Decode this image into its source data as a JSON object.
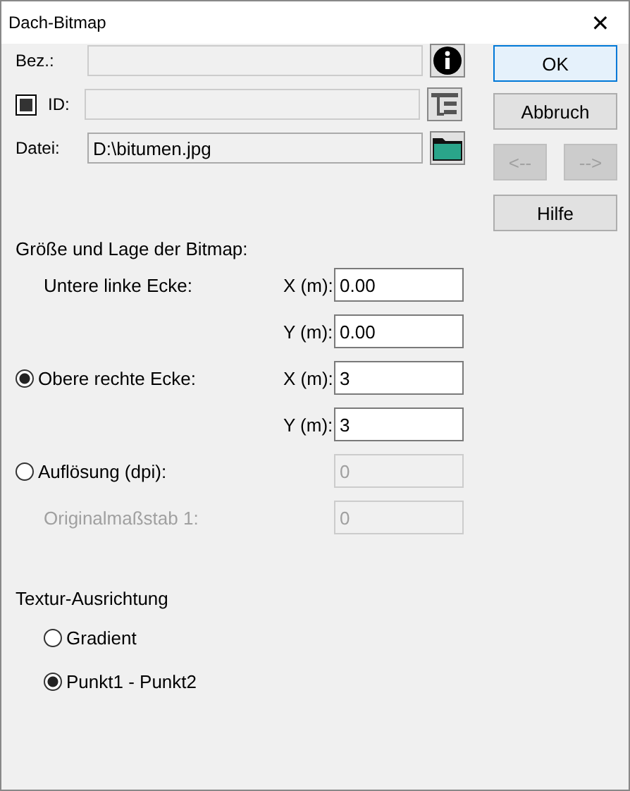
{
  "window": {
    "title": "Dach-Bitmap",
    "close": "✕"
  },
  "fields": [
    {
      "kind": "info",
      "label": "Bez.:"
    },
    {
      "kind": "id",
      "label": "ID:",
      "checked": true
    },
    {
      "kind": "file",
      "label": "Datei:",
      "value": "D:\\bitumen.jpg"
    }
  ],
  "buttons": [
    {
      "label": "OK",
      "default": true,
      "disabled": false,
      "wide": true
    },
    {
      "label": "Abbruch",
      "default": false,
      "disabled": false,
      "wide": true
    },
    {
      "label": "<--",
      "default": false,
      "disabled": true,
      "wide": false
    },
    {
      "label": "-->",
      "default": false,
      "disabled": true,
      "wide": false
    },
    {
      "label": "Hilfe",
      "default": false,
      "disabled": false,
      "wide": true
    }
  ],
  "size": {
    "title": "Größe und Lage der Bitmap:",
    "rows": [
      {
        "kind": "label",
        "label": "Untere linke Ecke:",
        "disabled": false,
        "field_label": "X (m):",
        "value": "0.00"
      },
      {
        "kind": "none",
        "disabled": false,
        "field_label": "Y (m):",
        "value": "0.00"
      },
      {
        "kind": "radio",
        "label": "Obere rechte Ecke:",
        "selected": true,
        "disabled": false,
        "field_label": "X (m):",
        "value": "3"
      },
      {
        "kind": "none",
        "disabled": false,
        "field_label": "Y (m):",
        "value": "3"
      },
      {
        "kind": "radio",
        "label": "Auflösung (dpi):",
        "selected": false,
        "disabled": true,
        "value": "0"
      },
      {
        "kind": "label",
        "label": "Originalmaßstab 1:",
        "disabled": true,
        "value": "0"
      }
    ]
  },
  "orientation": {
    "title": "Textur-Ausrichtung",
    "options": [
      {
        "label": "Gradient",
        "selected": false
      },
      {
        "label": "Punkt1 - Punkt2",
        "selected": true
      }
    ]
  }
}
